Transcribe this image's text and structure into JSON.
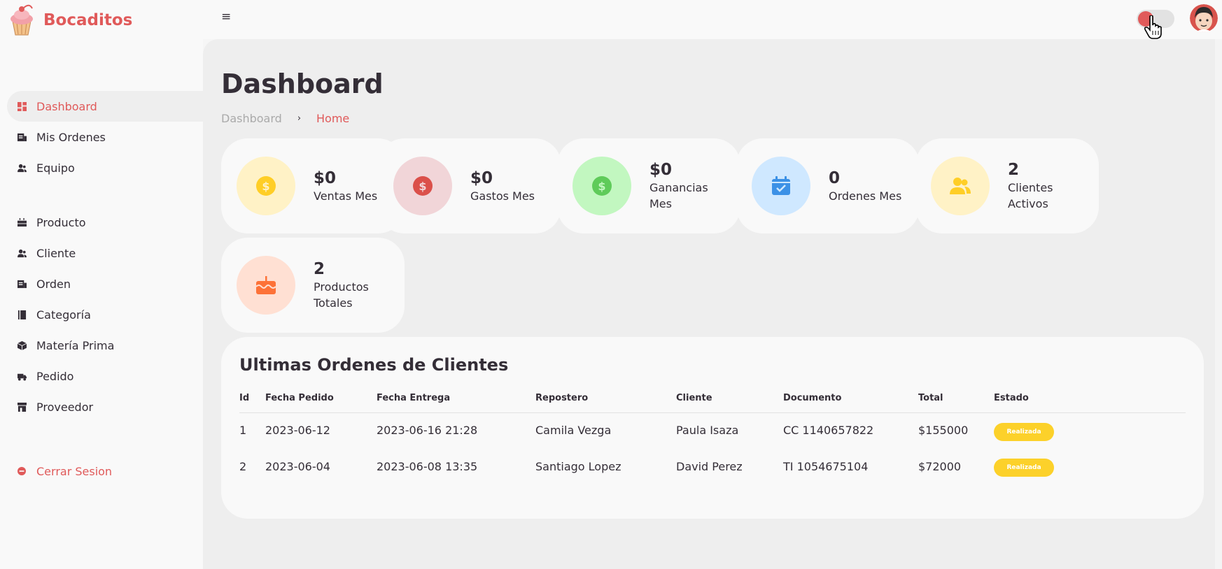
{
  "brand": {
    "name": "Bocaditos",
    "logo_icon": "cupcake-logo"
  },
  "topbar": {
    "menu_icon": "≡",
    "theme_toggle": "off",
    "accent": "#e05a5a"
  },
  "sidebar": {
    "top_items": [
      {
        "label": "Dashboard",
        "icon": "dashboard-icon",
        "active": true
      },
      {
        "label": "Mis Ordenes",
        "icon": "receipt-icon"
      },
      {
        "label": "Equipo",
        "icon": "users-icon"
      }
    ],
    "mid_items": [
      {
        "label": "Producto",
        "icon": "cake-icon"
      },
      {
        "label": "Cliente",
        "icon": "user-group-icon"
      },
      {
        "label": "Orden",
        "icon": "receipt-icon"
      },
      {
        "label": "Categoría",
        "icon": "book-icon"
      },
      {
        "label": "Matería Prima",
        "icon": "box-icon"
      },
      {
        "label": "Pedido",
        "icon": "truck-icon"
      },
      {
        "label": "Proveedor",
        "icon": "store-icon"
      }
    ],
    "logout": {
      "label": "Cerrar Sesion",
      "icon": "logout-icon"
    }
  },
  "main": {
    "title": "Dashboard",
    "breadcrumb": {
      "parent": "Dashboard",
      "separator": "›",
      "current": "Home"
    }
  },
  "cards": [
    {
      "value": "$0",
      "label": "Ventas Mes",
      "icon": "dollar-coin-icon",
      "bg": "#fff2c6",
      "fg": "#ffce26"
    },
    {
      "value": "$0",
      "label": "Gastos Mes",
      "icon": "dollar-coin-icon",
      "bg": "#f1d5d8",
      "fg": "#db504a"
    },
    {
      "value": "$0",
      "label": "Ganancias Mes",
      "icon": "dollar-coin-icon",
      "bg": "#c2f7c0",
      "fg": "#5fcb5a"
    },
    {
      "value": "0",
      "label": "Ordenes Mes",
      "icon": "calendar-check-icon",
      "bg": "#cfe8ff",
      "fg": "#3c91e6"
    },
    {
      "value": "2",
      "label": "Clientes Activos",
      "icon": "users-icon",
      "bg": "#fff2c6",
      "fg": "#ffce26"
    },
    {
      "value": "2",
      "label": "Productos Totales",
      "icon": "cake-icon",
      "bg": "#ffe0d3",
      "fg": "#fd7238"
    }
  ],
  "orders": {
    "title": "Ultimas Ordenes de Clientes",
    "columns": [
      "Id",
      "Fecha Pedido",
      "Fecha Entrega",
      "Repostero",
      "Cliente",
      "Documento",
      "Total",
      "Estado"
    ],
    "rows": [
      [
        "1",
        "2023-06-12",
        "2023-06-16 21:28",
        "Camila Vezga",
        "Paula Isaza",
        "CC 1140657822",
        "$155000",
        "Realizada"
      ],
      [
        "2",
        "2023-06-04",
        "2023-06-08 13:35",
        "Santiago Lopez",
        "David Perez",
        "TI 1054675104",
        "$72000",
        "Realizada"
      ]
    ],
    "status_color": "#fcd12a"
  }
}
